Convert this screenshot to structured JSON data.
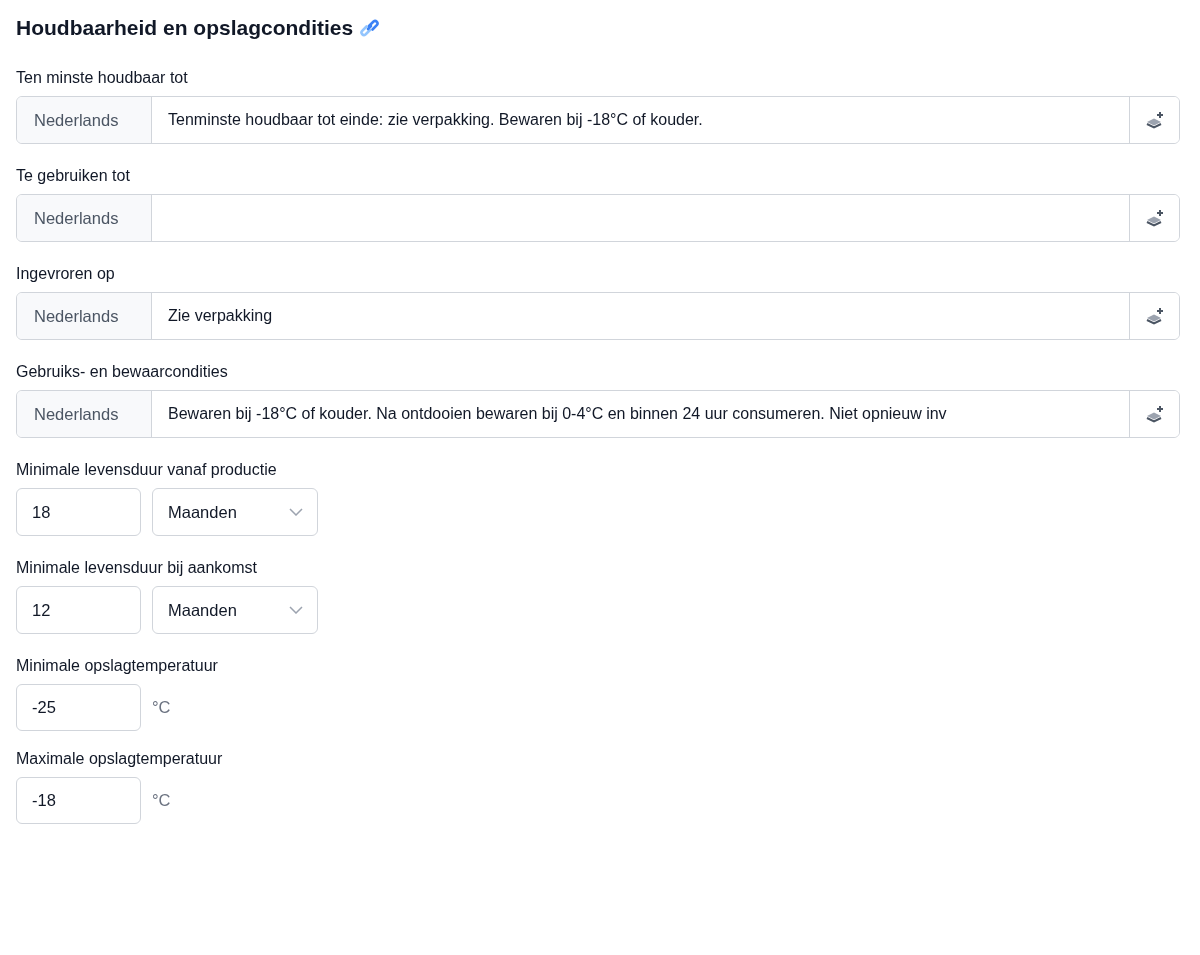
{
  "section": {
    "title": "Houdbaarheid en opslagcondities"
  },
  "fields": [
    {
      "kind": "translatable",
      "label": "Ten minste houdbaar tot",
      "language": "Nederlands",
      "value": "Tenminste houdbaar tot einde: zie verpakking. Bewaren bij -18°C of kouder."
    },
    {
      "kind": "translatable",
      "label": "Te gebruiken tot",
      "language": "Nederlands"
    },
    {
      "kind": "translatable",
      "label": "Ingevroren op",
      "language": "Nederlands",
      "value": "Zie verpakking"
    },
    {
      "kind": "translatable",
      "label": "Gebruiks- en bewaarcondities",
      "language": "Nederlands",
      "value": "Bewaren bij -18°C of kouder. Na ontdooien bewaren bij 0-4°C en binnen 24 uur consumeren. Niet opnieuw inv"
    },
    {
      "kind": "duration",
      "label": "Minimale levensduur vanaf productie",
      "value": "18",
      "unit": "Maanden"
    },
    {
      "kind": "duration",
      "label": "Minimale levensduur bij aankomst",
      "value": "12",
      "unit": "Maanden"
    },
    {
      "kind": "temperature",
      "label": "Minimale opslagtemperatuur",
      "value": "-25",
      "unit": "°C"
    },
    {
      "kind": "temperature",
      "label": "Maximale opslagtemperatuur",
      "value": "-18",
      "unit": "°C"
    }
  ]
}
